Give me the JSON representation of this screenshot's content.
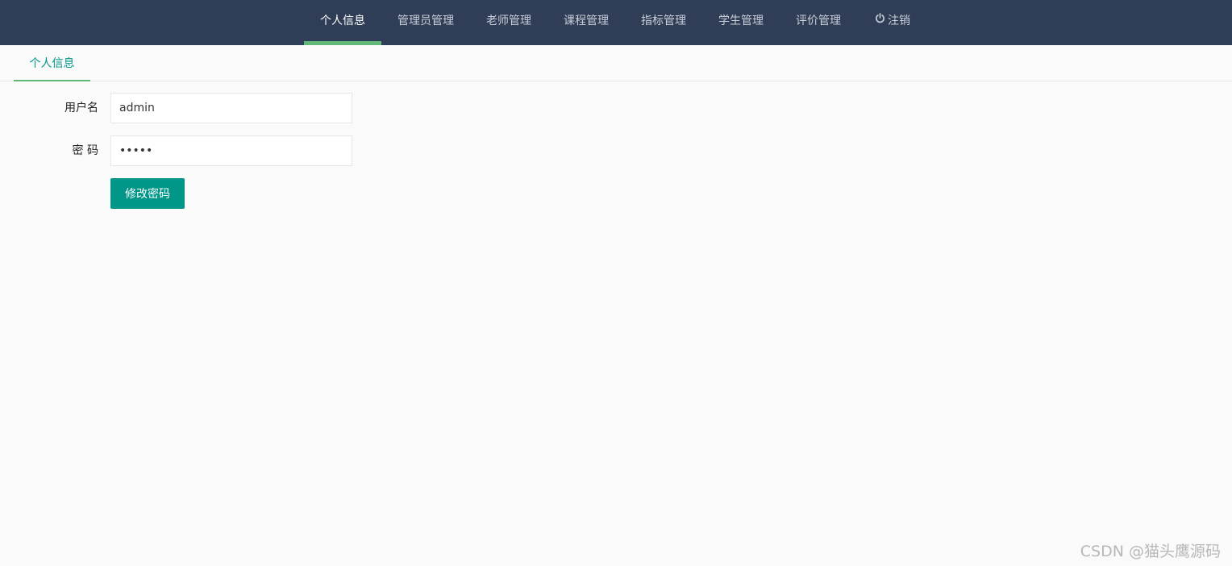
{
  "nav": {
    "items": [
      {
        "label": "个人信息",
        "active": true
      },
      {
        "label": "管理员管理",
        "active": false
      },
      {
        "label": "老师管理",
        "active": false
      },
      {
        "label": "课程管理",
        "active": false
      },
      {
        "label": "指标管理",
        "active": false
      },
      {
        "label": "学生管理",
        "active": false
      },
      {
        "label": "评价管理",
        "active": false
      }
    ],
    "logout": {
      "label": "注销",
      "icon": "power-icon"
    }
  },
  "tabs": [
    {
      "label": "个人信息",
      "active": true
    }
  ],
  "form": {
    "username_label": "用户名",
    "username_value": "admin",
    "password_label": "密 码",
    "password_value": "•••••",
    "submit_label": "修改密码"
  },
  "watermark": "CSDN @猫头鹰源码",
  "colors": {
    "header_bg": "#2f3e56",
    "active_indicator": "#5fb878",
    "primary": "#009688",
    "page_bg": "#fafafa"
  }
}
